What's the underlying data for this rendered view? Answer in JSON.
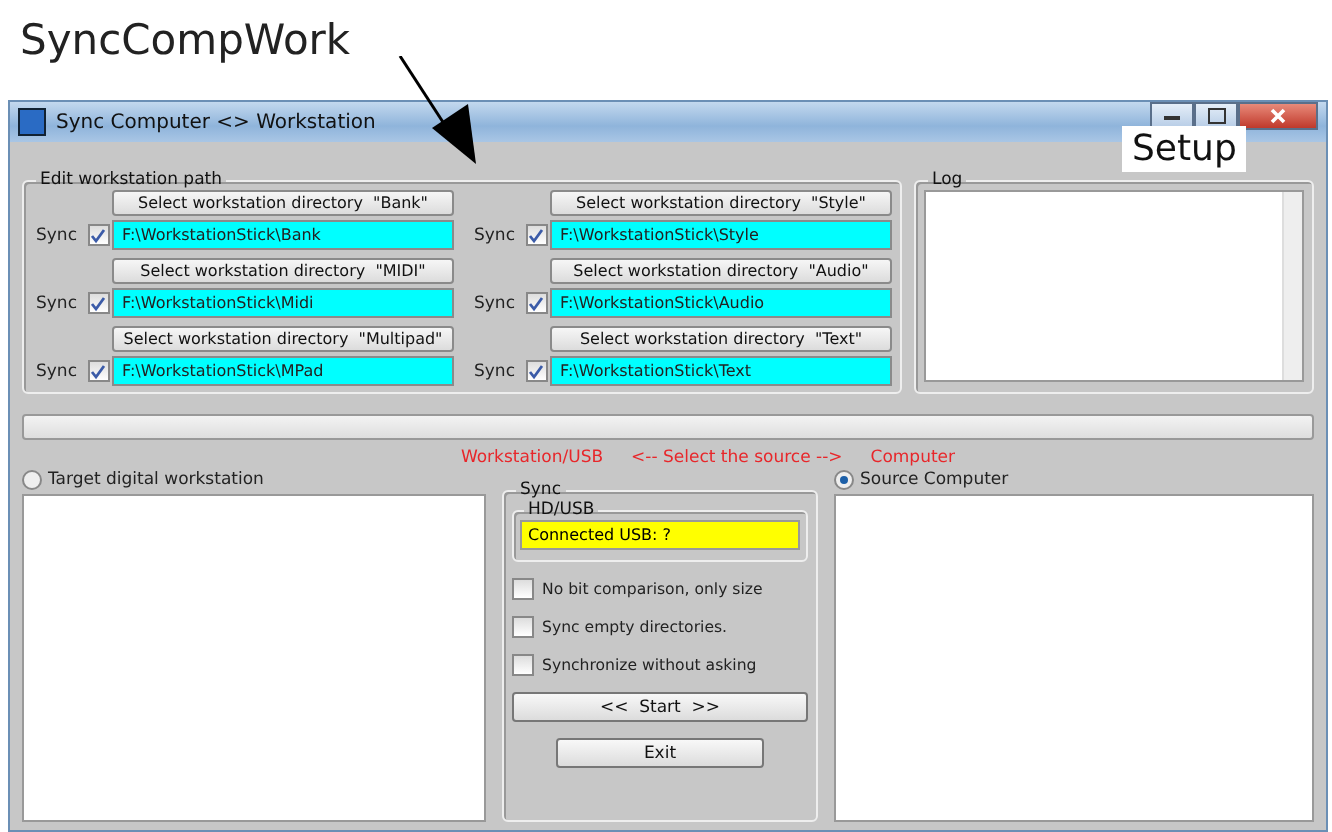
{
  "annotation": {
    "title": "SyncCompWork",
    "label": "Setup"
  },
  "window": {
    "title": "Sync Computer <> Workstation"
  },
  "edit_group": {
    "title": "Edit workstation path",
    "entries": [
      {
        "button": "Select workstation directory  \"Bank\"",
        "sync_label": "Sync",
        "sync": true,
        "path": "F:\\WorkstationStick\\Bank"
      },
      {
        "button": "Select workstation directory  \"Style\"",
        "sync_label": "Sync",
        "sync": true,
        "path": "F:\\WorkstationStick\\Style"
      },
      {
        "button": "Select workstation directory  \"MIDI\"",
        "sync_label": "Sync",
        "sync": true,
        "path": "F:\\WorkstationStick\\Midi"
      },
      {
        "button": "Select workstation directory  \"Audio\"",
        "sync_label": "Sync",
        "sync": true,
        "path": "F:\\WorkstationStick\\Audio"
      },
      {
        "button": "Select workstation directory  \"Multipad\"",
        "sync_label": "Sync",
        "sync": true,
        "path": "F:\\WorkstationStick\\MPad"
      },
      {
        "button": "Select workstation directory  \"Text\"",
        "sync_label": "Sync",
        "sync": true,
        "path": "F:\\WorkstationStick\\Text"
      }
    ]
  },
  "log": {
    "title": "Log"
  },
  "progress": {
    "level": 0
  },
  "source_hint": {
    "left": "Workstation/USB",
    "middle": "<-- Select the source -->",
    "right": "Computer"
  },
  "radios": [
    {
      "label": "Target digital workstation",
      "selected": false
    },
    {
      "label": "Source Computer",
      "selected": true
    }
  ],
  "sync_group": {
    "title": "Sync",
    "hd_title": "HD/USB",
    "usb_status": "Connected USB: ?",
    "options": [
      {
        "label": "No bit comparison, only size",
        "checked": false
      },
      {
        "label": "Sync empty directories.",
        "checked": false
      },
      {
        "label": "Synchronize without asking",
        "checked": false
      }
    ],
    "buttons": [
      "<<  Start  >>",
      "Exit"
    ]
  }
}
